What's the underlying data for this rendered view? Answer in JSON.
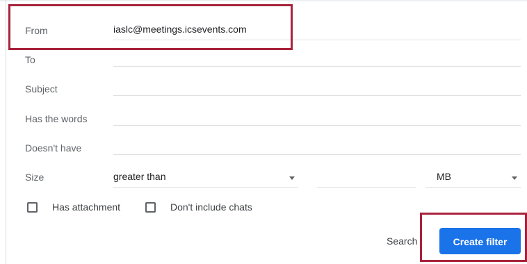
{
  "filter_form": {
    "from": {
      "label": "From",
      "value": "iaslc@meetings.icsevents.com"
    },
    "to": {
      "label": "To",
      "value": ""
    },
    "subject": {
      "label": "Subject",
      "value": ""
    },
    "has_words": {
      "label": "Has the words",
      "value": ""
    },
    "doesnt_have": {
      "label": "Doesn't have",
      "value": ""
    },
    "size": {
      "label": "Size",
      "operator": "greater than",
      "amount": "",
      "unit": "MB"
    },
    "has_attachment": {
      "label": "Has attachment",
      "checked": false
    },
    "dont_include_chats": {
      "label": "Don't include chats",
      "checked": false
    },
    "search_label": "Search",
    "create_filter_label": "Create filter"
  },
  "colors": {
    "highlight": "#a8223b",
    "primary_button": "#1a73e8"
  }
}
